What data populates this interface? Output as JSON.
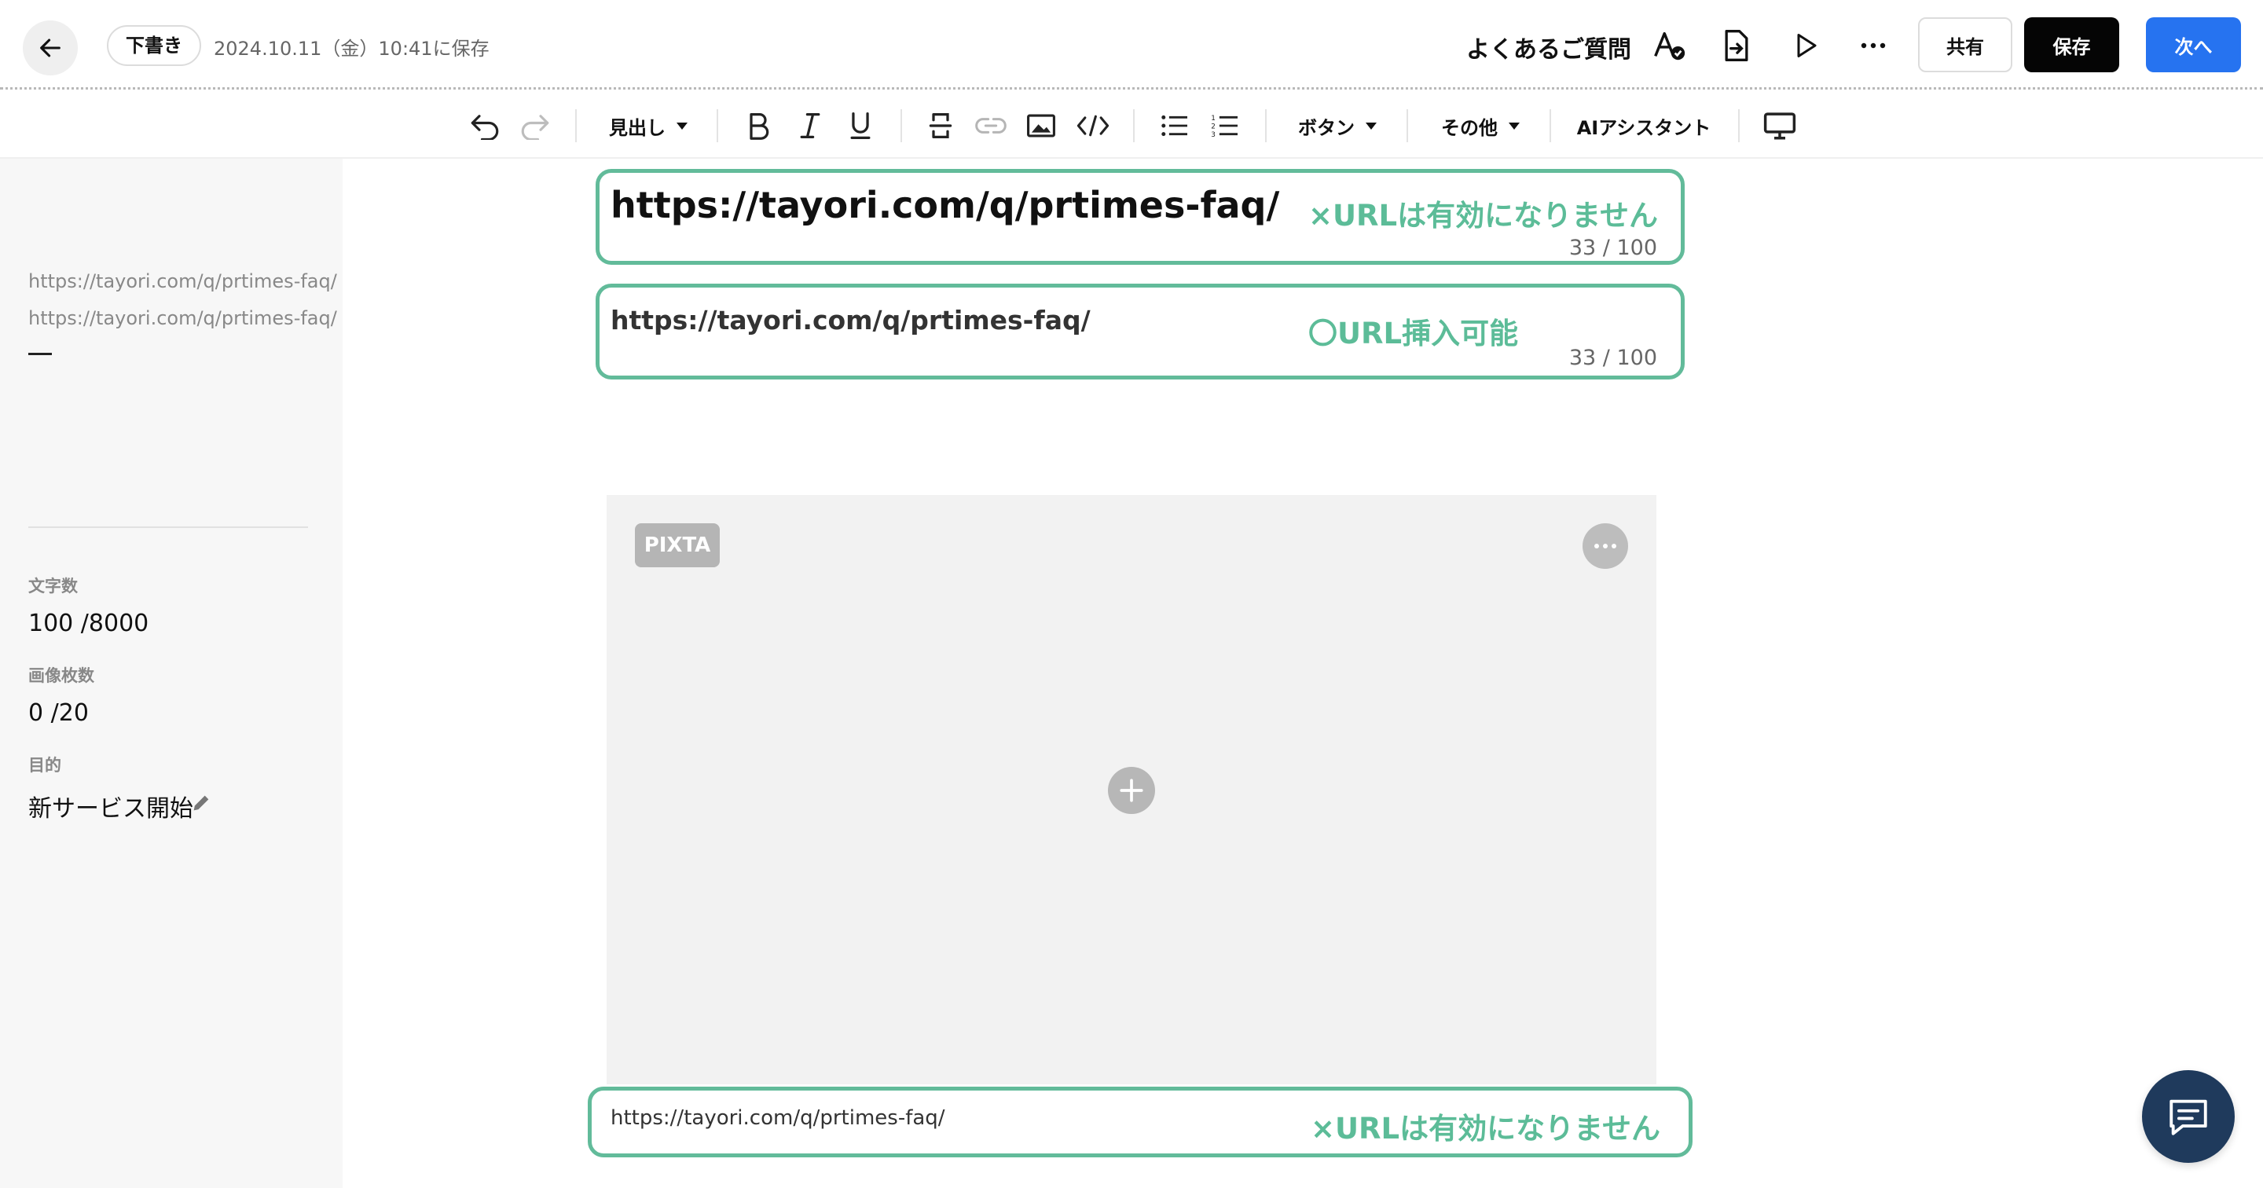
{
  "header": {
    "status_badge": "下書き",
    "saved_text": "2024.10.11（金）10:41に保存",
    "title": "よくあるご質問",
    "share_label": "共有",
    "save_label": "保存",
    "next_label": "次へ"
  },
  "toolbar": {
    "heading_label": "見出し",
    "button_label": "ボタン",
    "other_label": "その他",
    "ai_label": "AIアシスタント"
  },
  "sidebar": {
    "urls": [
      "https://tayori.com/q/prtimes-faq/",
      "https://tayori.com/q/prtimes-faq/"
    ],
    "char_count_label": "文字数",
    "char_count_value": "100 /8000",
    "image_count_label": "画像枚数",
    "image_count_value": "0 /20",
    "purpose_label": "目的",
    "purpose_value": "新サービス開始"
  },
  "main": {
    "title_field": {
      "value": "https://tayori.com/q/prtimes-faq/",
      "counter": "33 / 100",
      "note": "×URLは有効になりません"
    },
    "subtitle_field": {
      "value": "https://tayori.com/q/prtimes-faq/",
      "counter": "33 / 100",
      "note": "〇URL挿入可能"
    },
    "image": {
      "badge": "PIXTA"
    },
    "caption_field": {
      "value": "https://tayori.com/q/prtimes-faq/",
      "note": "×URLは有効になりません"
    }
  },
  "colors": {
    "accent_green": "#5cbc98",
    "primary_blue": "#2673f0",
    "chat_navy": "#1f3a5c"
  },
  "icons": {
    "back": "arrow-left-icon",
    "spellcheck": "text-check-icon",
    "export": "file-export-icon",
    "preview": "play-icon",
    "more": "more-horizontal-icon",
    "undo": "undo-icon",
    "redo": "redo-icon",
    "bold": "bold-icon",
    "italic": "italic-icon",
    "underline": "underline-icon",
    "strike": "strikethrough-icon",
    "link": "link-icon",
    "image": "image-icon",
    "code": "code-icon",
    "bullet_list": "bullet-list-icon",
    "number_list": "numbered-list-icon",
    "device_preview": "monitor-icon",
    "edit": "pencil-icon",
    "add": "plus-icon",
    "chat": "chat-icon"
  }
}
